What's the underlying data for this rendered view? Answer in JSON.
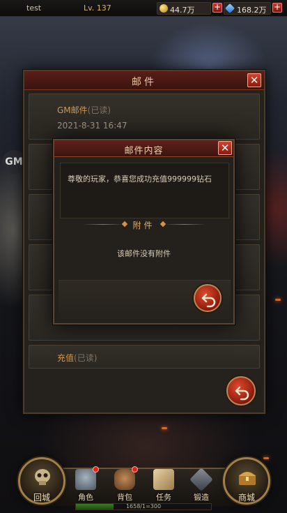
{
  "top_bar": {
    "player_name": "test",
    "level": "Lv. 137",
    "gold": "44.7万",
    "gems": "168.2万",
    "plus_symbol": "+"
  },
  "side_button": {
    "label": "GM"
  },
  "mail_panel": {
    "title": "邮件",
    "close_symbol": "✕",
    "items": [
      {
        "subject": "GM邮件",
        "status": "(已读)",
        "date": "2021-8-31  16:47"
      },
      {
        "subject": "",
        "status": "",
        "date": ""
      },
      {
        "subject": "",
        "status": "",
        "date": ""
      },
      {
        "subject": "",
        "status": "",
        "date": ""
      },
      {
        "subject": "",
        "status": "",
        "date": ""
      },
      {
        "subject": "充值",
        "status": "(已读)",
        "date": ""
      }
    ]
  },
  "mail_detail": {
    "title": "邮件内容",
    "close_symbol": "✕",
    "body": "尊敬的玩家，恭喜您成功充值999999钻石",
    "attachment_header": "附件",
    "no_attachment_text": "该邮件没有附件"
  },
  "bottom_nav": {
    "home_label": "回城",
    "shop_label": "商城",
    "items": [
      {
        "label": "角色",
        "icon": "helmet-icon",
        "badge": true
      },
      {
        "label": "背包",
        "icon": "bag-icon",
        "badge": true
      },
      {
        "label": "任务",
        "icon": "scroll-icon",
        "badge": false
      },
      {
        "label": "锻造",
        "icon": "forge-icon",
        "badge": false
      }
    ],
    "exp_text": "1658/1=300",
    "exp_fraction": 0.28
  },
  "colors": {
    "accent_red": "#c83a2a",
    "title_gold": "#e7c9a4",
    "subject_orange": "#d89848"
  }
}
